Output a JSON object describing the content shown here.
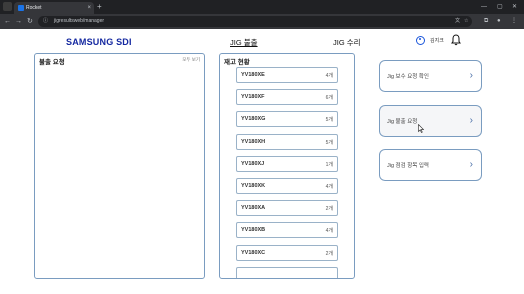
{
  "browser": {
    "tab_title": "Rocket",
    "url": "jigresultsweb/manager",
    "new_tab_symbol": "+",
    "tab_close_symbol": "×"
  },
  "header": {
    "brand": "SAMSUNG SDI",
    "nav": [
      "JIG 불출",
      "JIG 수리"
    ],
    "active_nav": "JIG 불출",
    "user_name": "김지크"
  },
  "request_panel": {
    "title": "불출 요청",
    "link": "모두 보기"
  },
  "stock_panel": {
    "title": "재고 현황",
    "items": [
      {
        "name": "YV180XE",
        "qty": "4개"
      },
      {
        "name": "YV180XF",
        "qty": "6개"
      },
      {
        "name": "YV180XG",
        "qty": "5개"
      },
      {
        "name": "YV180XH",
        "qty": "5개"
      },
      {
        "name": "YV180XJ",
        "qty": "1개"
      },
      {
        "name": "YV180XK",
        "qty": "4개"
      },
      {
        "name": "YV180XA",
        "qty": "2개"
      },
      {
        "name": "YV180XB",
        "qty": "4개"
      },
      {
        "name": "YV180XC",
        "qty": "2개"
      }
    ]
  },
  "actions": [
    {
      "label": "Jig 보수 요청 확인"
    },
    {
      "label": "Jig 불출 요청"
    },
    {
      "label": "Jig 점검 항목 입력"
    }
  ],
  "colors": {
    "brand": "#1428a0",
    "panel_border": "#7a9cc0",
    "accent": "#1a56db"
  }
}
